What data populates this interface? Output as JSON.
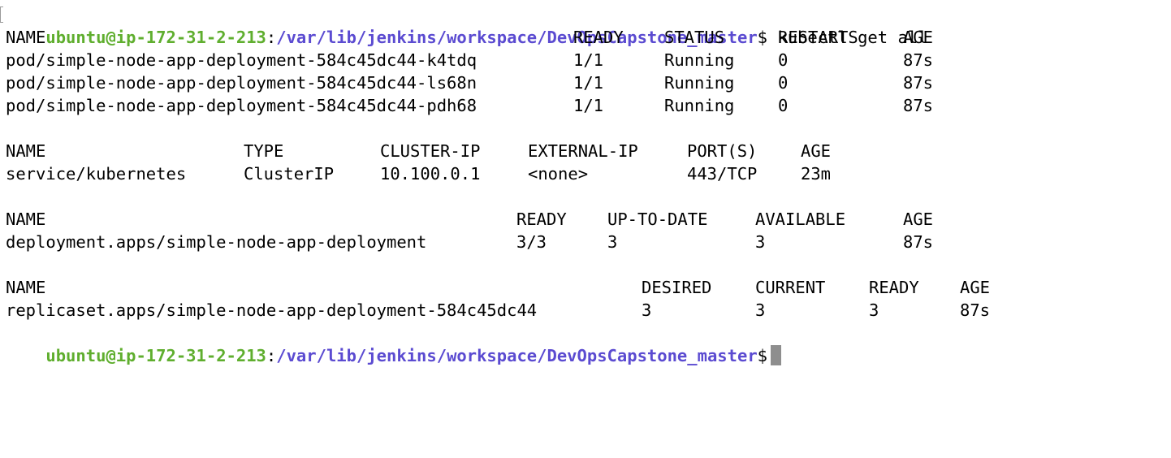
{
  "prompt": {
    "user_host": "ubuntu@ip-172-31-2-213",
    "separator": ":",
    "cwd": "/var/lib/jenkins/workspace/DevOpsCapstone_master",
    "symbol": "$"
  },
  "command": " kubectl get all",
  "pods": {
    "headers": [
      "NAME",
      "READY",
      "STATUS",
      "RESTARTS",
      "AGE"
    ],
    "rows": [
      [
        "pod/simple-node-app-deployment-584c45dc44-k4tdq",
        "1/1",
        "Running",
        "0",
        "87s"
      ],
      [
        "pod/simple-node-app-deployment-584c45dc44-ls68n",
        "1/1",
        "Running",
        "0",
        "87s"
      ],
      [
        "pod/simple-node-app-deployment-584c45dc44-pdh68",
        "1/1",
        "Running",
        "0",
        "87s"
      ]
    ]
  },
  "services": {
    "headers": [
      "NAME",
      "TYPE",
      "CLUSTER-IP",
      "EXTERNAL-IP",
      "PORT(S)",
      "AGE"
    ],
    "rows": [
      [
        "service/kubernetes",
        "ClusterIP",
        "10.100.0.1",
        "<none>",
        "443/TCP",
        "23m"
      ]
    ]
  },
  "deployments": {
    "headers": [
      "NAME",
      "READY",
      "UP-TO-DATE",
      "AVAILABLE",
      "AGE"
    ],
    "rows": [
      [
        "deployment.apps/simple-node-app-deployment",
        "3/3",
        "3",
        "3",
        "87s"
      ]
    ]
  },
  "replicasets": {
    "headers": [
      "NAME",
      "DESIRED",
      "CURRENT",
      "READY",
      "AGE"
    ],
    "rows": [
      [
        "replicaset.apps/simple-node-app-deployment-584c45dc44",
        "3",
        "3",
        "3",
        "87s"
      ]
    ]
  },
  "colors": {
    "prompt_user": "#5fae2e",
    "prompt_path": "#5b4bd1",
    "text": "#000000",
    "cursor": "#8e8e8e",
    "background": "#ffffff"
  }
}
